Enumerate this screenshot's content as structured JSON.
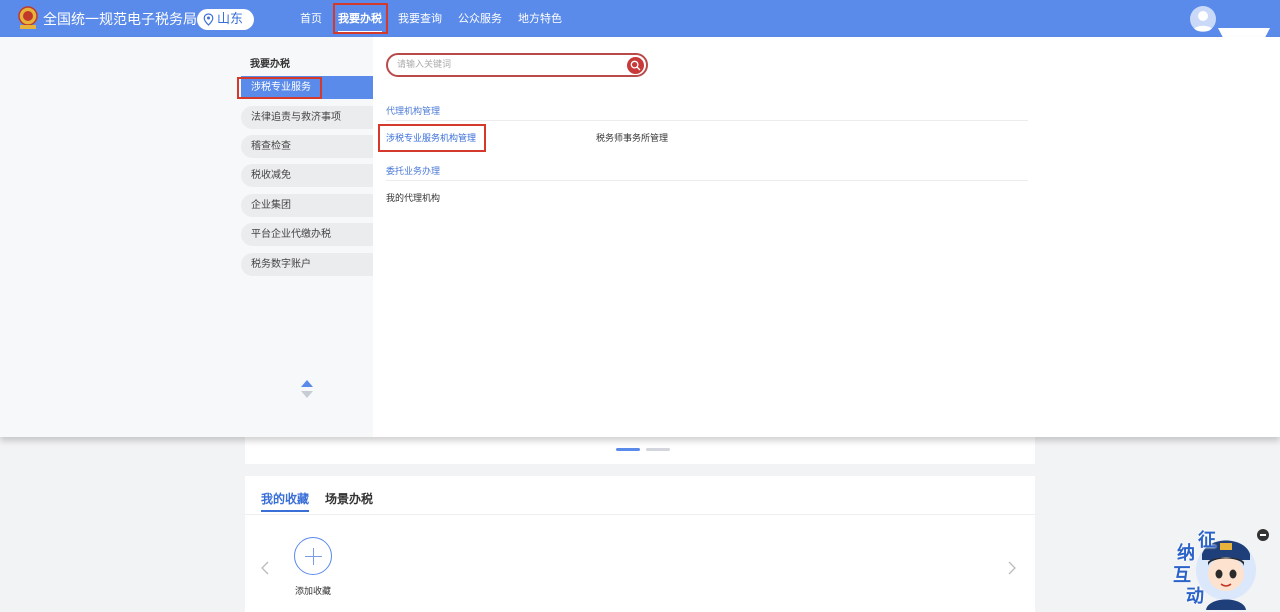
{
  "header": {
    "site_title": "全国统一规范电子税务局",
    "region": "山东",
    "nav": [
      "首页",
      "我要办税",
      "我要查询",
      "公众服务",
      "地方特色"
    ],
    "active_nav": "我要办税"
  },
  "dropdown": {
    "category_title": "我要办税",
    "categories": [
      "涉税专业服务",
      "法律追责与救济事项",
      "稽查检查",
      "税收减免",
      "企业集团",
      "平台企业代缴办税",
      "税务数字账户"
    ],
    "active_category": "涉税专业服务",
    "search_placeholder": "请输入关键词",
    "sections": [
      {
        "title": "代理机构管理",
        "items": [
          "涉税专业服务机构管理",
          "税务师事务所管理"
        ]
      },
      {
        "title": "委托业务办理",
        "items": [
          "我的代理机构"
        ]
      }
    ]
  },
  "favorites": {
    "tabs": [
      "我的收藏",
      "场景办税"
    ],
    "add_label": "添加收藏"
  },
  "mascot": {
    "chars": [
      "征",
      "纳",
      "互",
      "动"
    ]
  },
  "colors": {
    "header_blue": "#5b8bea",
    "highlight_red": "#d33a2c",
    "link_blue": "#3a6fd8"
  }
}
